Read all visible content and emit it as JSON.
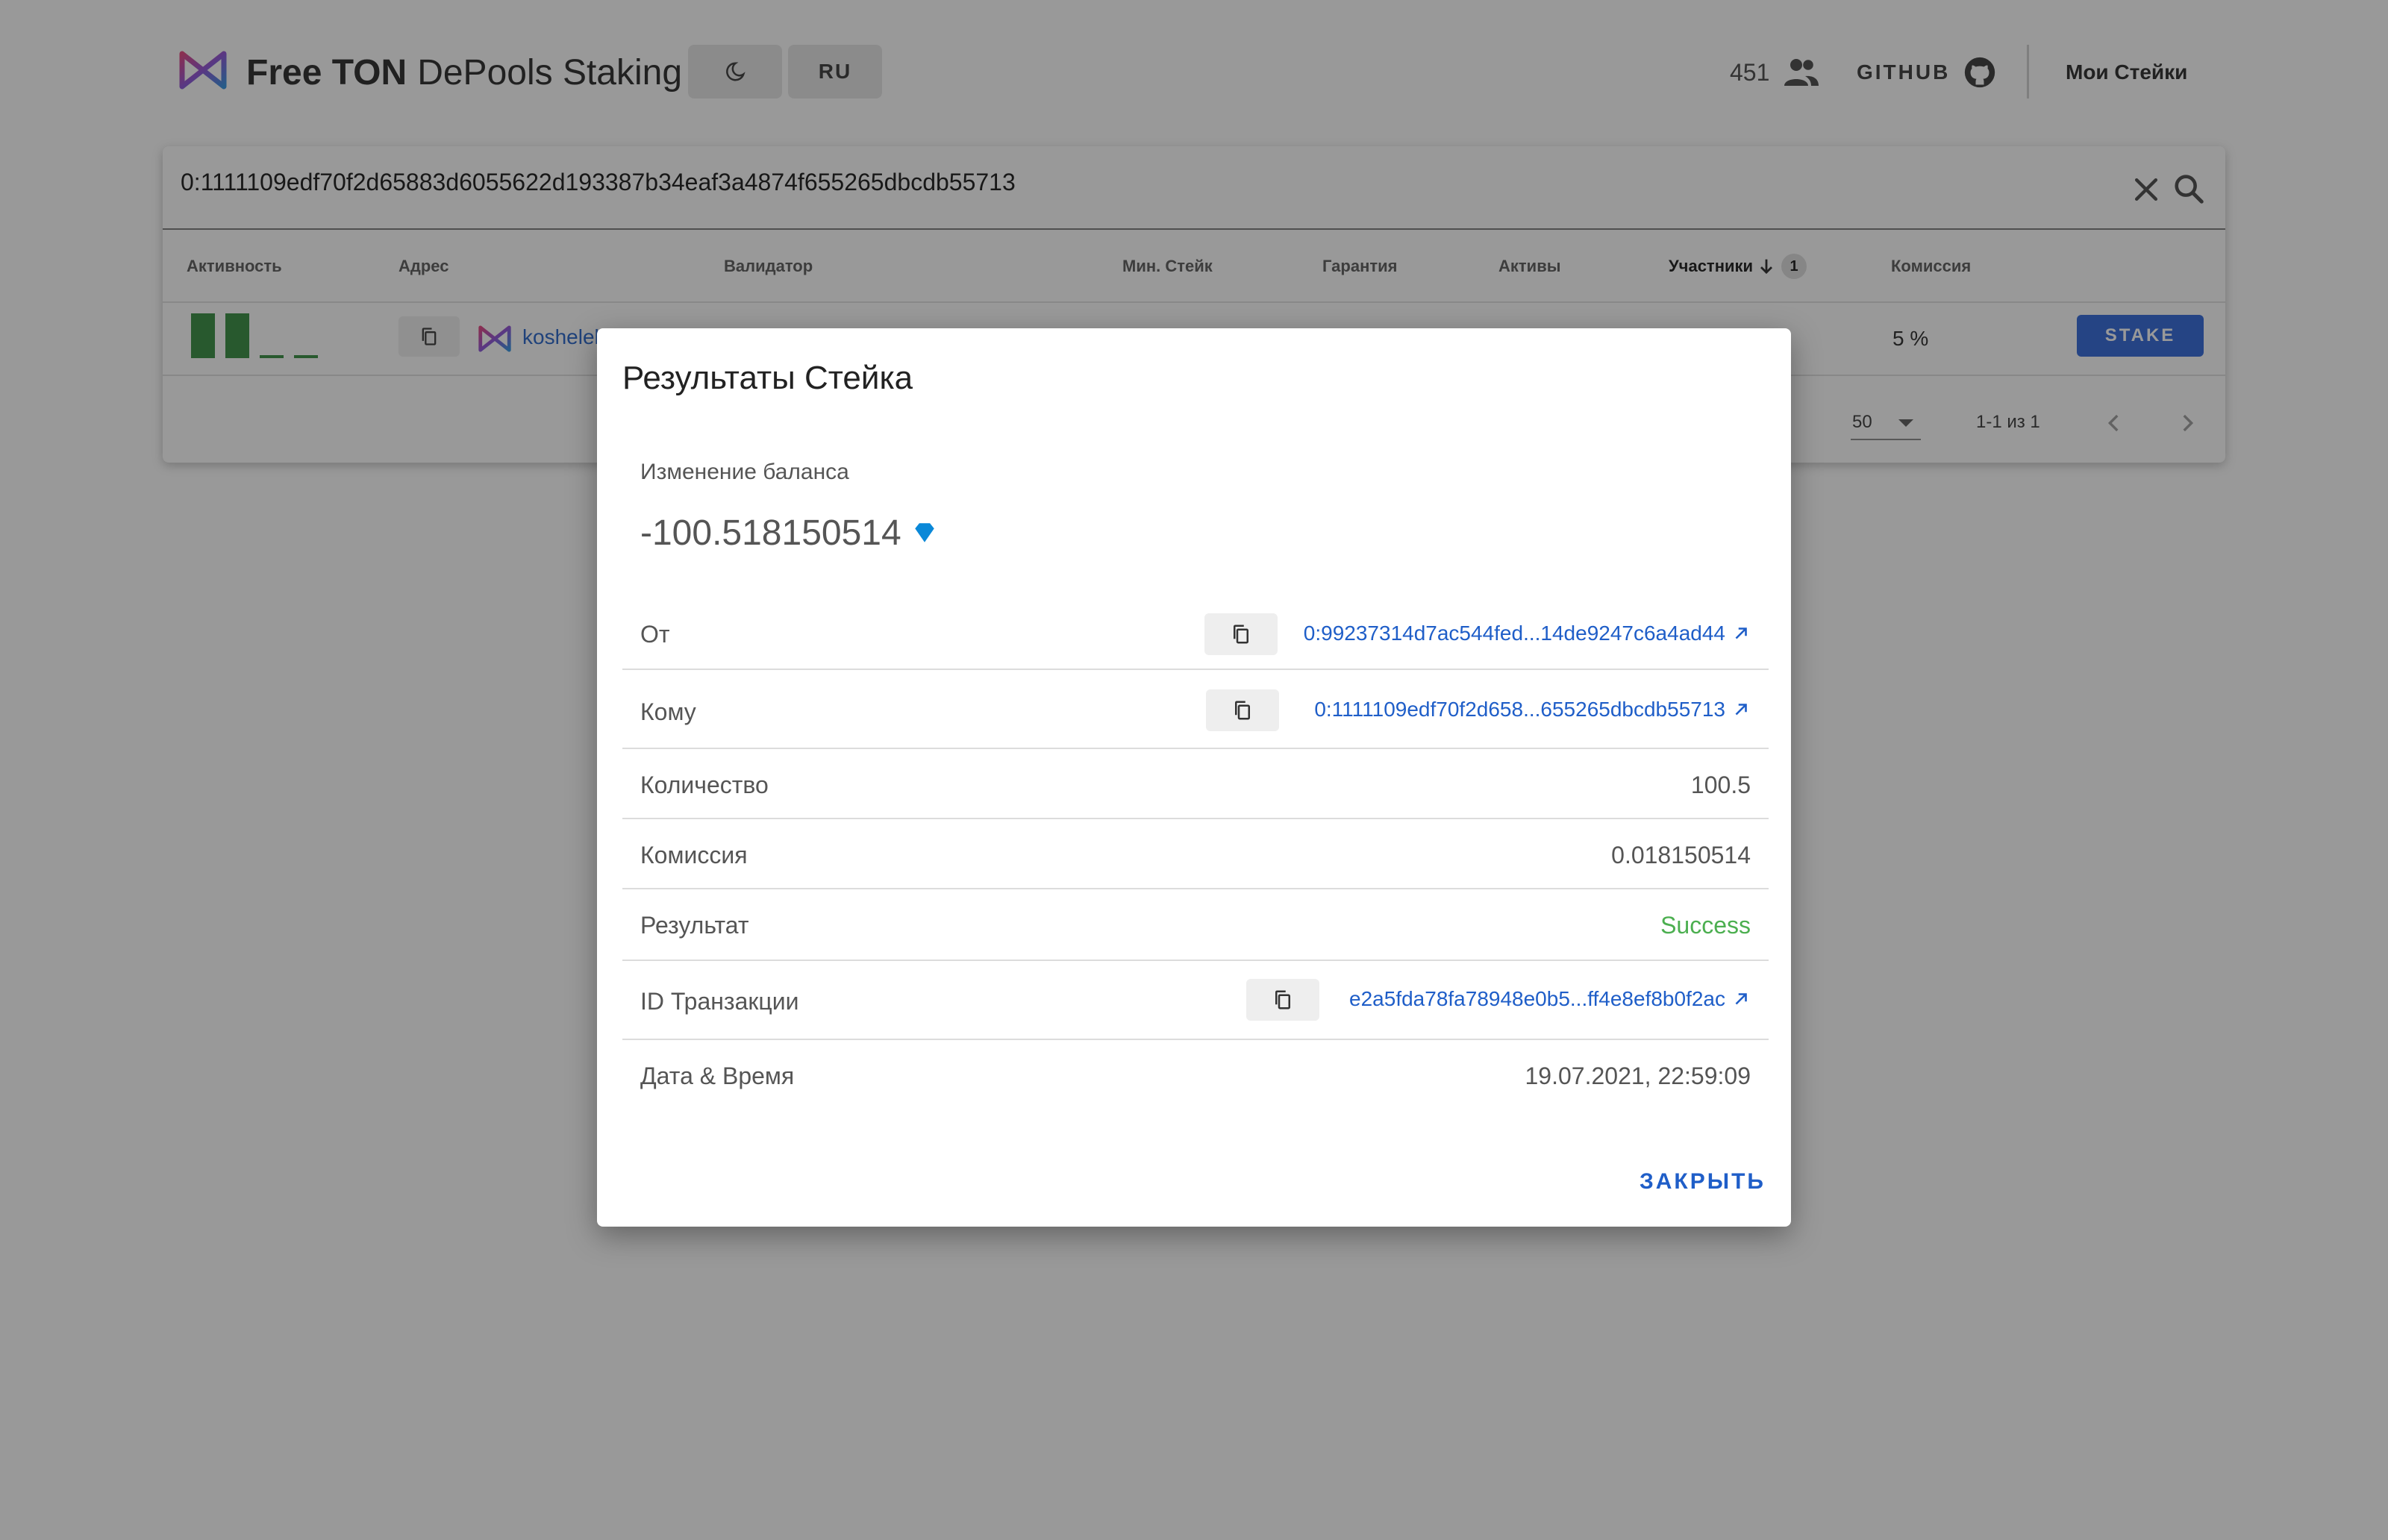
{
  "header": {
    "brand_bold": "Free TON",
    "brand_light": "DePools Staking",
    "theme_icon": "moon-icon",
    "lang_label": "RU",
    "online_count": "451",
    "github_label": "GITHUB",
    "my_stakes_label": "Мои Стейки"
  },
  "search": {
    "value": "0:1111109edf70f2d65883d6055622d193387b34eaf3a4874f655265dbcdb55713"
  },
  "table": {
    "columns": {
      "activity": "Активность",
      "address": "Адрес",
      "validator": "Валидатор",
      "min_stake": "Мин. Стейк",
      "guarantee": "Гарантия",
      "assets": "Активы",
      "participants": "Участники",
      "participants_sort_badge": "1",
      "commission": "Комиссия"
    },
    "row": {
      "activity_levels": [
        1,
        1,
        0,
        0
      ],
      "address_link": "koshelek",
      "commission": "5 %",
      "stake_button": "STAKE"
    },
    "footer": {
      "rows_per_page": "50",
      "range": "1-1 из 1"
    }
  },
  "dialog": {
    "title": "Результаты Стейка",
    "balance_label": "Изменение баланса",
    "balance_value": "-100.518150514",
    "rows": {
      "from_label": "От",
      "from_value": "0:99237314d7ac544fed...14de9247c6a4ad44",
      "to_label": "Кому",
      "to_value": "0:1111109edf70f2d658...655265dbcdb55713",
      "amount_label": "Количество",
      "amount_value": "100.5",
      "fee_label": "Комиссия",
      "fee_value": "0.018150514",
      "result_label": "Результат",
      "result_value": "Success",
      "tx_label": "ID Транзакции",
      "tx_value": "e2a5fda78fa78948e0b5...ff4e8ef8b0f2ac",
      "date_label": "Дата & Время",
      "date_value": "19.07.2021, 22:59:09"
    },
    "close_label": "ЗАКРЫТЬ"
  },
  "colors": {
    "accent": "#1f5ec8",
    "stake_button": "#2962d9",
    "success": "#4caf50",
    "activity_bar": "#2f8a3a",
    "ton_diamond": "#0a88d8"
  }
}
